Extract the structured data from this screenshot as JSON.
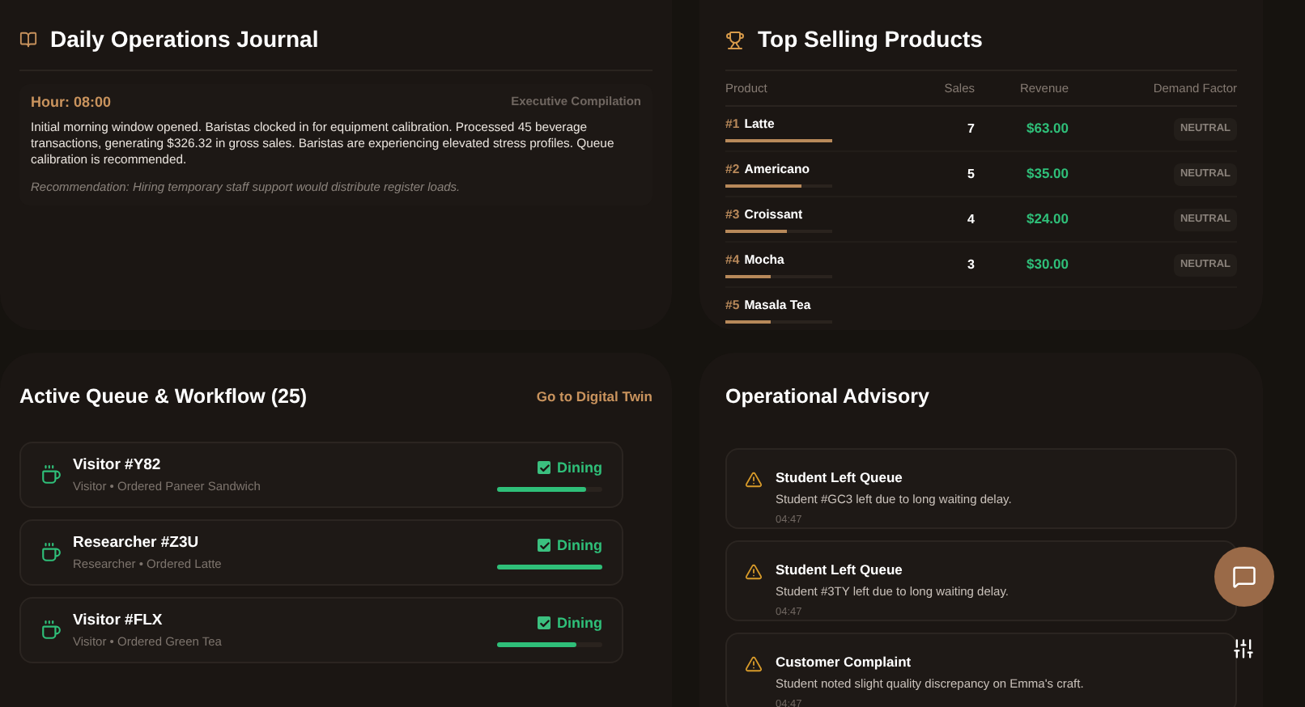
{
  "journal": {
    "title": "Daily Operations Journal",
    "entries": [
      {
        "hour": "Hour: 08:00",
        "source": "Executive Compilation",
        "text": "Initial morning window opened. Baristas clocked in for equipment calibration. Processed 45 beverage transactions, generating $326.32 in gross sales. Baristas are experiencing elevated stress profiles. Queue calibration is recommended.",
        "recommendation": "Recommendation: Hiring temporary staff support would distribute register loads."
      }
    ]
  },
  "top_products": {
    "title": "Top Selling Products",
    "columns": [
      "Product",
      "Sales",
      "Revenue",
      "Demand Factor"
    ],
    "rows": [
      {
        "rank": "#1",
        "name": "Latte",
        "level": 1.0,
        "sales": "7",
        "revenue": "$63.00",
        "demand": "NEUTRAL"
      },
      {
        "rank": "#2",
        "name": "Americano",
        "level": 0.71,
        "sales": "5",
        "revenue": "$35.00",
        "demand": "NEUTRAL"
      },
      {
        "rank": "#3",
        "name": "Croissant",
        "level": 0.57,
        "sales": "4",
        "revenue": "$24.00",
        "demand": "NEUTRAL"
      },
      {
        "rank": "#4",
        "name": "Mocha",
        "level": 0.43,
        "sales": "3",
        "revenue": "$30.00",
        "demand": "NEUTRAL"
      },
      {
        "rank": "#5",
        "name": "Masala Tea",
        "level": 0.43
      }
    ]
  },
  "queue": {
    "title": "Active Queue & Workflow (25)",
    "link": "Go to Digital Twin",
    "items": [
      {
        "name": "Visitor #Y82",
        "detail": "Visitor • Ordered Paneer Sandwich",
        "status": "Dining",
        "checked": true,
        "level": 0.85
      },
      {
        "name": "Researcher #Z3U",
        "detail": "Researcher • Ordered Latte",
        "status": "Dining",
        "checked": true,
        "level": 1.0
      },
      {
        "name": "Visitor #FLX",
        "detail": "Visitor • Ordered Green Tea",
        "status": "Dining",
        "checked": true,
        "level": 0.75
      }
    ]
  },
  "advisory": {
    "title": "Operational Advisory",
    "items": [
      {
        "title": "Student Left Queue",
        "text": "Student #GC3 left due to long waiting delay.",
        "time": "04:47"
      },
      {
        "title": "Student Left Queue",
        "text": "Student #3TY left due to long waiting delay.",
        "time": "04:47"
      },
      {
        "title": "Customer Complaint",
        "text": "Student noted slight quality discrepancy on Emma's craft.",
        "time": "04:47"
      }
    ]
  }
}
